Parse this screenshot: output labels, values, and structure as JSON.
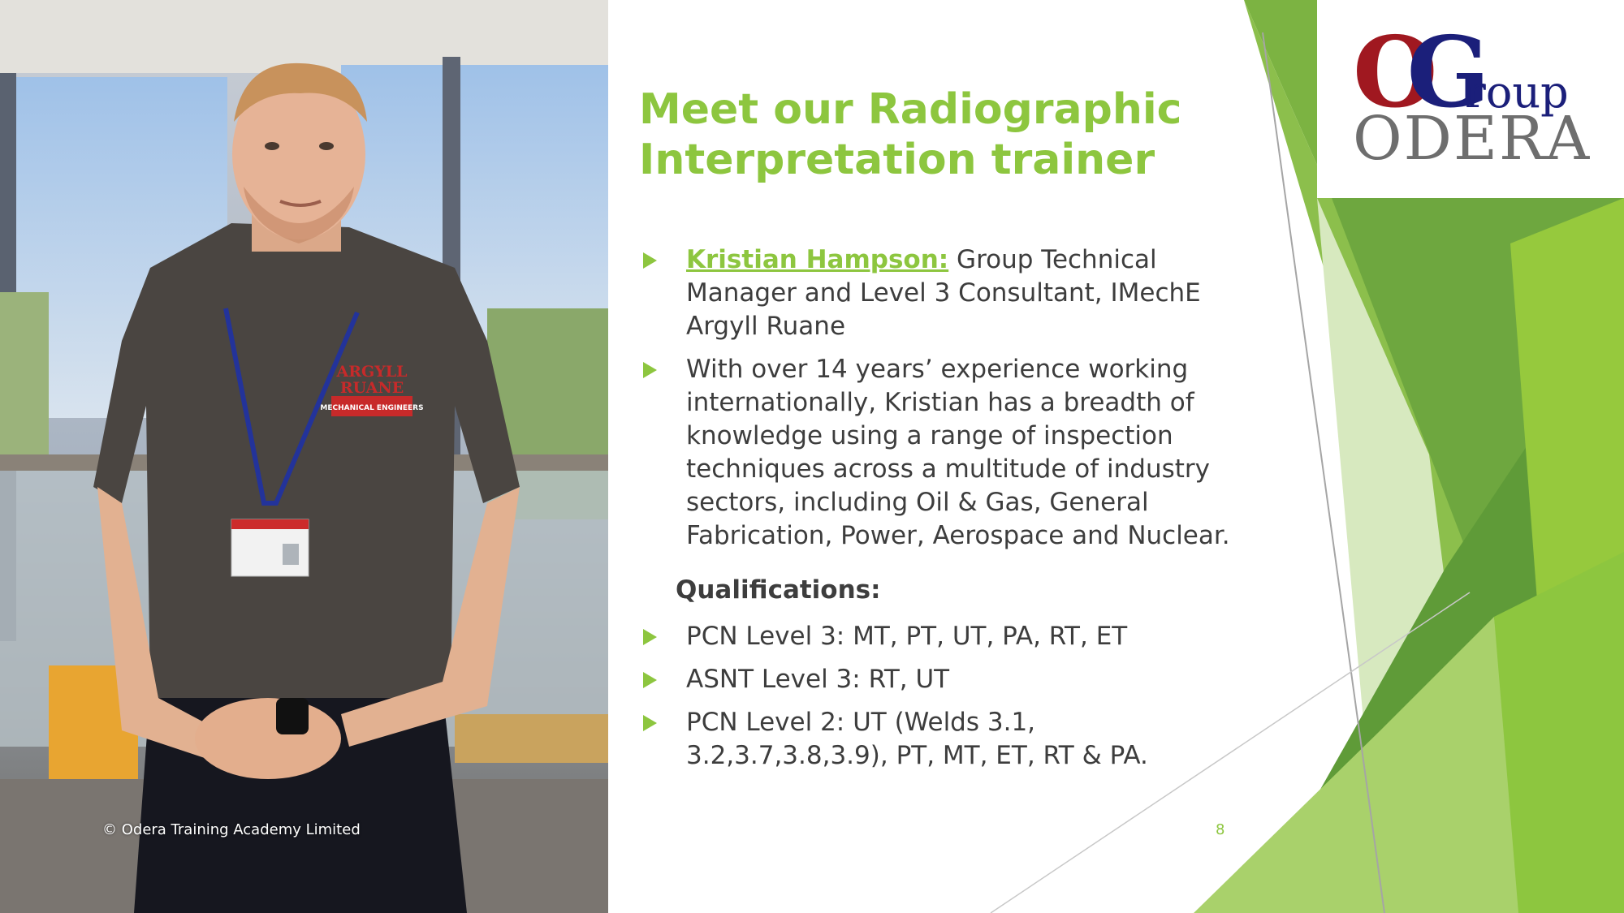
{
  "slide": {
    "title": "Meet our Radiographic Interpretation trainer",
    "bio": {
      "name": "Kristian Hampson:",
      "role": " Group Technical Manager and Level 3 Consultant, IMechE Argyll Ruane",
      "experience": "With over 14 years’ experience working internationally, Kristian has a breadth of knowledge using a range of inspection techniques across a multitude of industry sectors, including Oil & Gas, General Fabrication, Power, Aerospace and Nuclear."
    },
    "qualifications": {
      "heading": "Qualifications:",
      "items": [
        "PCN Level 3: MT, PT, UT, PA, RT, ET",
        "ASNT Level 3: RT, UT",
        "PCN Level 2: UT (Welds 3.1, 3.2,3.7,3.8,3.9), PT, MT, ET, RT & PA."
      ]
    },
    "copyright": "© Odera Training Academy Limited",
    "page_number": "8"
  },
  "logo": {
    "letter_o": "O",
    "letter_g": "G",
    "roup": "roup",
    "odera": "ODERA"
  },
  "photo": {
    "shirt_text_1": "ARGYLL",
    "shirt_text_2": "RUANE",
    "shirt_text_3": "MECHANICAL ENGINEERS"
  },
  "colors": {
    "accent_green": "#8dc63f",
    "logo_red": "#a01820",
    "logo_blue": "#1b1f7a",
    "logo_gray": "#6e6e6e",
    "text": "#3d3d3d"
  }
}
